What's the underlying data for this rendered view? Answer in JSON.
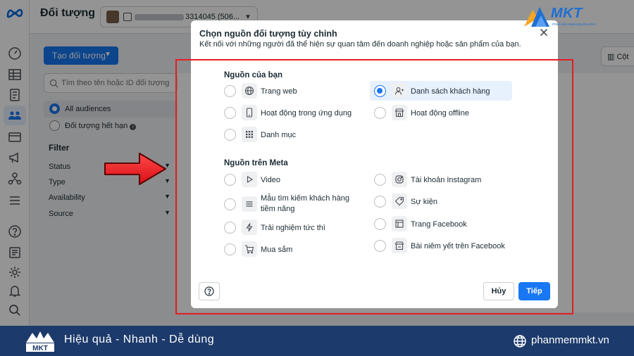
{
  "app": {
    "page_title": "Đối tượng",
    "account_number": "3314045 (506...",
    "create_button": "Tạo đối tượng",
    "search_placeholder": "Tìm theo tên hoặc ID đối tượng",
    "audience_items": [
      {
        "label": "All audiences",
        "selected": true
      },
      {
        "label": "Đối tượng hết hạn",
        "selected": false
      }
    ],
    "filter": {
      "title": "Filter",
      "rows": [
        "Status",
        "Type",
        "Availability",
        "Source"
      ]
    },
    "columns_button": "Cột"
  },
  "modal": {
    "title": "Chọn nguồn đối tượng tùy chỉnh",
    "subtitle": "Kết nối với những người đã thể hiện sự quan tâm đến doanh nghiệp hoặc sản phẩm của bạn.",
    "sections": [
      {
        "title": "Nguồn của bạn",
        "options": [
          {
            "label": "Trang web",
            "icon": "globe-icon",
            "selected": false
          },
          {
            "label": "Danh sách khách hàng",
            "icon": "customer-list-icon",
            "selected": true
          },
          {
            "label": "Hoạt động trong ứng dụng",
            "icon": "mobile-icon",
            "selected": false
          },
          {
            "label": "Hoạt động offline",
            "icon": "store-icon",
            "selected": false
          },
          {
            "label": "Danh mục",
            "icon": "grid-icon",
            "selected": false
          }
        ]
      },
      {
        "title": "Nguồn trên Meta",
        "options": [
          {
            "label": "Video",
            "icon": "play-icon",
            "selected": false
          },
          {
            "label": "Tài khoản Instagram",
            "icon": "instagram-icon",
            "selected": false
          },
          {
            "label": "Mẫu tìm kiếm khách hàng tiềm năng",
            "icon": "form-lines-icon",
            "selected": false
          },
          {
            "label": "Sự kiện",
            "icon": "tag-icon",
            "selected": false
          },
          {
            "label": "Trải nghiệm tức thì",
            "icon": "lightning-icon",
            "selected": false
          },
          {
            "label": "Trang Facebook",
            "icon": "page-icon",
            "selected": false
          },
          {
            "label": "Mua sắm",
            "icon": "cart-icon",
            "selected": false
          },
          {
            "label": "Bài niêm yết trên Facebook",
            "icon": "marketplace-icon",
            "selected": false
          }
        ]
      }
    ],
    "cancel_label": "Hủy",
    "next_label": "Tiếp"
  },
  "branding": {
    "logo_text": "MKT",
    "logo_slogan": "Phần mềm Marketing Đa Kênh",
    "footer_slogan": "Hiệu quả - Nhanh - Dễ dùng",
    "footer_site": "phanmemmkt.vn"
  },
  "colors": {
    "accent": "#1877f2",
    "highlight_frame": "#e31e24",
    "footer_bg": "#1c3a6b",
    "selected_bg": "#e7f0fd"
  }
}
